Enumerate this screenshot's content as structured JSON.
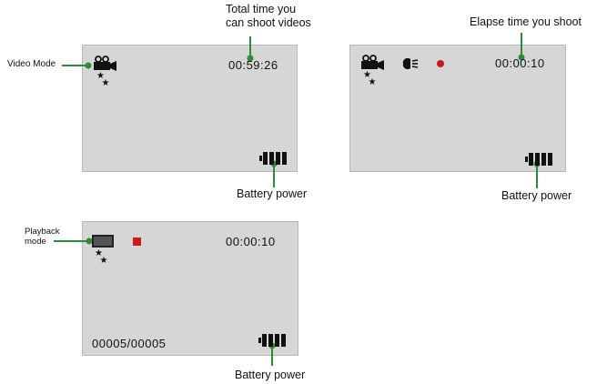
{
  "panel_video": {
    "mode_label": "Video Mode",
    "remaining_time": "00:59:26",
    "remaining_label_line1": "Total time you",
    "remaining_label_line2": "can shoot videos",
    "battery_label": "Battery power",
    "icon": "video-camera-icon"
  },
  "panel_recording": {
    "elapsed_time": "00:00:10",
    "elapsed_label": "Elapse time you shoot",
    "battery_label": "Battery power",
    "icons": [
      "video-camera-icon",
      "light-icon",
      "record-dot-icon"
    ]
  },
  "panel_playback": {
    "mode_label_line1": "Playback",
    "mode_label_line2": "mode",
    "time": "00:00:10",
    "file_counter": "00005/00005",
    "battery_label": "Battery power",
    "icons": [
      "playback-screen-icon",
      "stop-square-icon"
    ]
  },
  "colors": {
    "screen_bg": "#d6d6d6",
    "leader_line": "#2e8b3a",
    "record_red": "#d01818"
  }
}
